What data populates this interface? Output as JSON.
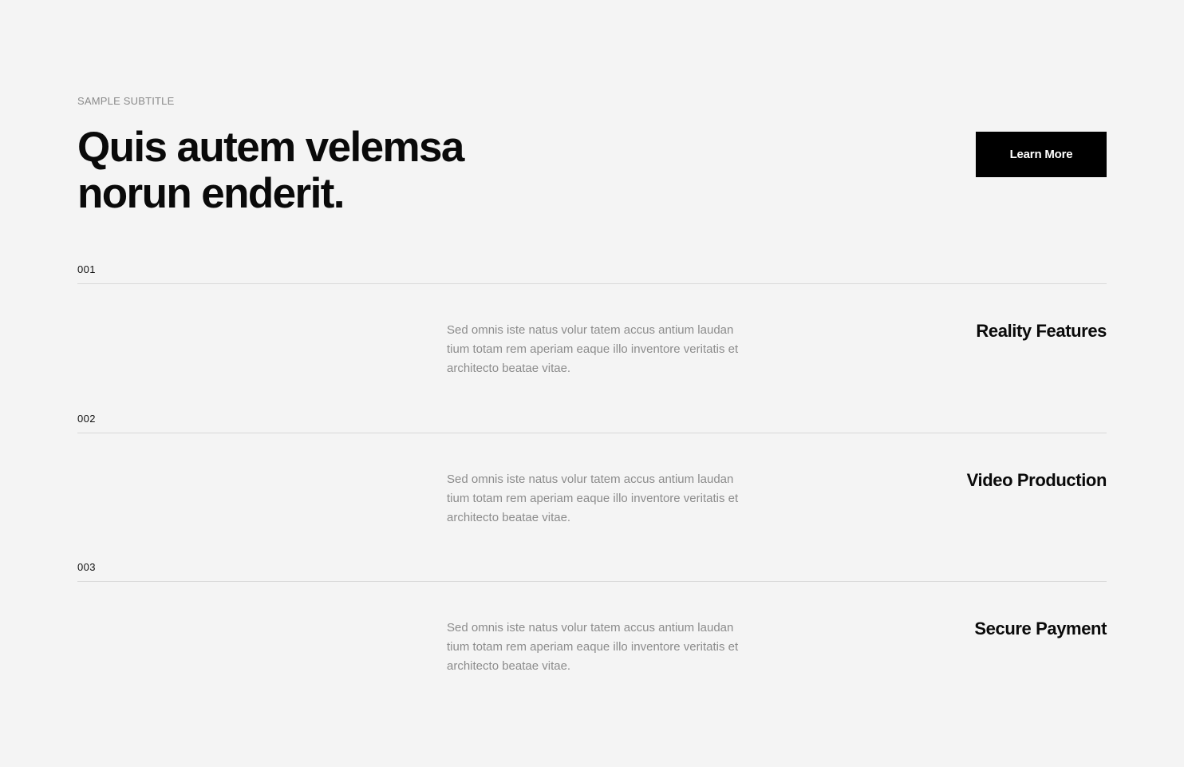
{
  "header": {
    "subtitle": "SAMPLE SUBTITLE",
    "headline": "Quis autem velemsa norun enderit.",
    "cta_label": "Learn More"
  },
  "items": [
    {
      "number": "001",
      "title": "Reality Features",
      "description": "Sed omnis iste natus volur tatem accus antium laudan tium totam rem aperiam eaque illo inventore veritatis et architecto beatae vitae."
    },
    {
      "number": "002",
      "title": "Video Production",
      "description": "Sed omnis iste natus volur tatem accus antium laudan tium totam rem aperiam eaque illo inventore veritatis et architecto beatae vitae."
    },
    {
      "number": "003",
      "title": "Secure Payment",
      "description": "Sed omnis iste natus volur tatem accus antium laudan tium totam rem aperiam eaque illo inventore veritatis et architecto beatae vitae."
    }
  ]
}
